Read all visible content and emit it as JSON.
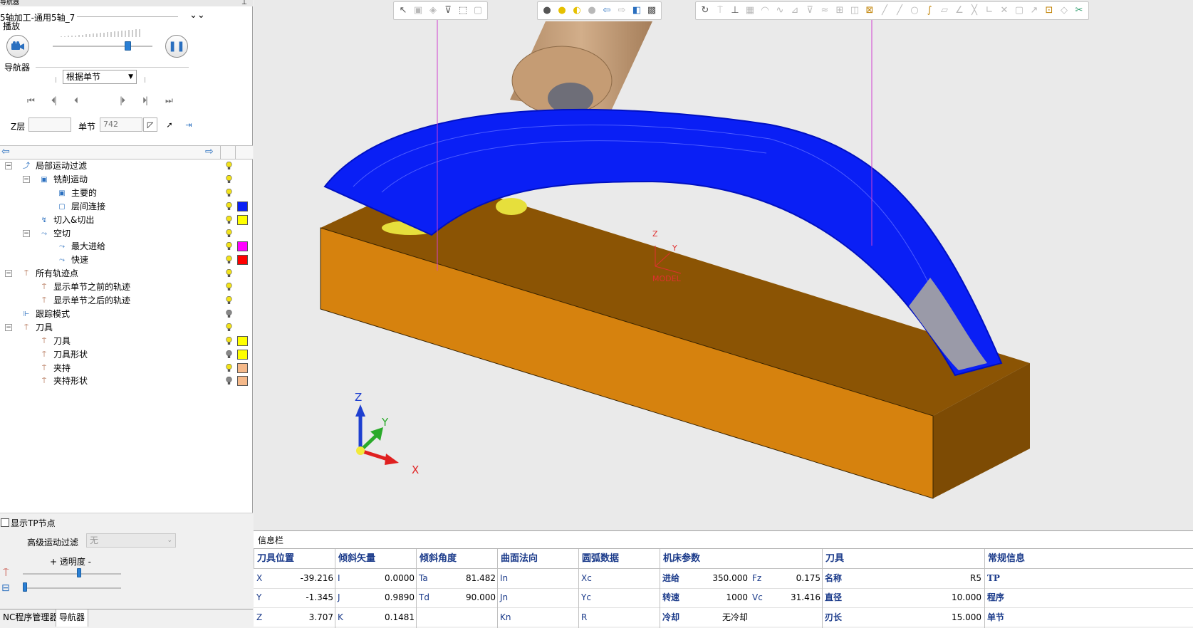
{
  "navigator": {
    "header_title": "导航器",
    "project_title": "5轴加工-通用5轴_7",
    "playback_label": "播放",
    "navigator_label": "导航器",
    "step_mode": "根据单节",
    "z_layer_label": "Z层",
    "z_layer_value": "",
    "block_label": "单节",
    "block_value": "742"
  },
  "tree": [
    {
      "label": "局部运动过滤",
      "level": 0,
      "expander": "−",
      "swatch": ""
    },
    {
      "label": "铣削运动",
      "level": 1,
      "expander": "−",
      "swatch": ""
    },
    {
      "label": "主要的",
      "level": 2,
      "expander": "",
      "swatch": ""
    },
    {
      "label": "层间连接",
      "level": 2,
      "expander": "",
      "swatch": "#0a1ff5"
    },
    {
      "label": "切入&切出",
      "level": 1,
      "expander": "",
      "swatch": "#ffff00"
    },
    {
      "label": "空切",
      "level": 1,
      "expander": "−",
      "swatch": ""
    },
    {
      "label": "最大进给",
      "level": 2,
      "expander": "",
      "swatch": "#ff00ff"
    },
    {
      "label": "快速",
      "level": 2,
      "expander": "",
      "swatch": "#ff0000"
    },
    {
      "label": "所有轨迹点",
      "level": 0,
      "expander": "−",
      "swatch": ""
    },
    {
      "label": "显示单节之前的轨迹",
      "level": 1,
      "expander": "",
      "swatch": ""
    },
    {
      "label": "显示单节之后的轨迹",
      "level": 1,
      "expander": "",
      "swatch": ""
    },
    {
      "label": "跟踪模式",
      "level": 0,
      "expander": "",
      "swatch": ""
    },
    {
      "label": "刀具",
      "level": 0,
      "expander": "−",
      "swatch": ""
    },
    {
      "label": "刀具",
      "level": 1,
      "expander": "",
      "swatch": "#ffff00"
    },
    {
      "label": "刀具形状",
      "level": 1,
      "expander": "",
      "swatch": "#ffff00"
    },
    {
      "label": "夹持",
      "level": 1,
      "expander": "",
      "swatch": "#f5b98a"
    },
    {
      "label": "夹持形状",
      "level": 1,
      "expander": "",
      "swatch": "#f5b98a"
    }
  ],
  "options": {
    "show_tp_nodes": "显示TP节点",
    "advanced_filter_label": "高级运动过滤",
    "advanced_filter_value": "无",
    "transparency_label": "+ 透明度 -"
  },
  "tabs": {
    "nc_manager": "NC程序管理器",
    "navigator": "导航器"
  },
  "viewport": {
    "model_label": "MODEL",
    "axis_x": "X",
    "axis_y": "Y",
    "axis_z": "Z"
  },
  "info_bar": {
    "title": "信息栏",
    "headers": [
      "刀具位置",
      "倾斜矢量",
      "倾斜角度",
      "曲面法向",
      "圆弧数据",
      "机床参数",
      "刀具",
      "常规信息"
    ],
    "tool_position": [
      {
        "key": "X",
        "value": "-39.216"
      },
      {
        "key": "Y",
        "value": "-1.345"
      },
      {
        "key": "Z",
        "value": "3.707"
      }
    ],
    "tilt_vector": [
      {
        "key": "I",
        "value": "0.0000"
      },
      {
        "key": "J",
        "value": "0.9890"
      },
      {
        "key": "K",
        "value": "0.1481"
      }
    ],
    "tilt_angle": [
      {
        "key": "Ta",
        "value": "81.482"
      },
      {
        "key": "Td",
        "value": "90.000"
      },
      {
        "key": "",
        "value": ""
      }
    ],
    "surface_normal": [
      {
        "key": "In",
        "value": ""
      },
      {
        "key": "Jn",
        "value": ""
      },
      {
        "key": "Kn",
        "value": ""
      }
    ],
    "arc_data": [
      {
        "key": "Xc",
        "value": ""
      },
      {
        "key": "Yc",
        "value": ""
      },
      {
        "key": "R",
        "value": ""
      }
    ],
    "machine": [
      {
        "key": "进给",
        "value": "350.000",
        "key2": "Fz",
        "value2": "0.175"
      },
      {
        "key": "转速",
        "value": "1000",
        "key2": "Vc",
        "value2": "31.416"
      },
      {
        "key": "冷却",
        "value": "无冷却",
        "key2": "",
        "value2": ""
      }
    ],
    "tool": [
      {
        "key": "名称",
        "value": "R5"
      },
      {
        "key": "直径",
        "value": "10.000"
      },
      {
        "key": "刃长",
        "value": "15.000"
      }
    ],
    "general": [
      {
        "key": "TP",
        "value": ""
      },
      {
        "key": "程序",
        "value": ""
      },
      {
        "key": "单节",
        "value": ""
      }
    ]
  },
  "colors": {
    "toolpath": "#0a1ff5",
    "stock": "#d6820e",
    "holder": "#c7a07a",
    "header_text": "#1a3a8a"
  }
}
